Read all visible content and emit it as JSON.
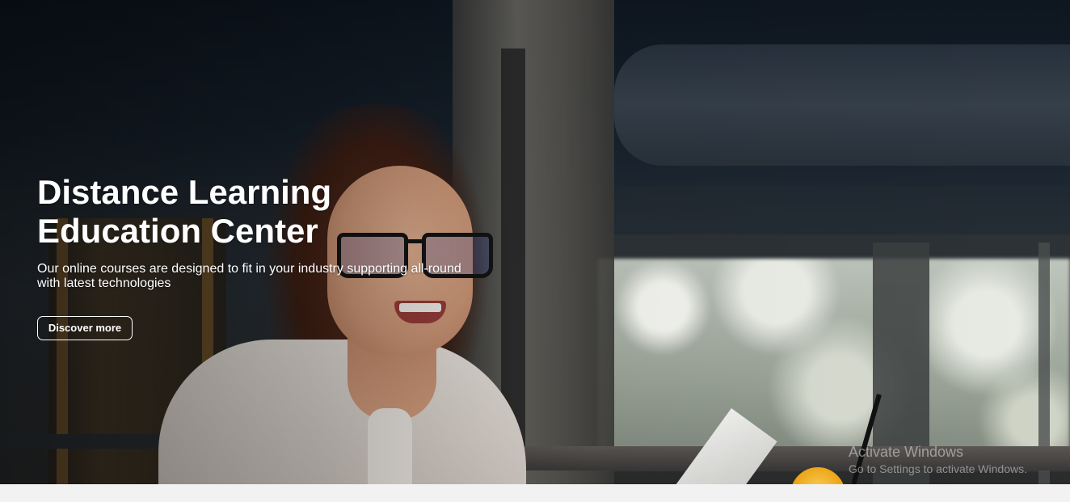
{
  "hero": {
    "title_line1": "Distance Learning",
    "title_line2": "Education Center",
    "subtitle_line1": "Our online courses are designed to fit in your industry supporting all-round",
    "subtitle_line2": "with latest technologies",
    "cta_label": "Discover more",
    "image_description_icon": "hero-photo"
  },
  "os_watermark": {
    "title": "Activate Windows",
    "subtitle": "Go to Settings to activate Windows."
  },
  "colors": {
    "hero_text": "#ffffff",
    "page_background": "#f2f2f2"
  }
}
